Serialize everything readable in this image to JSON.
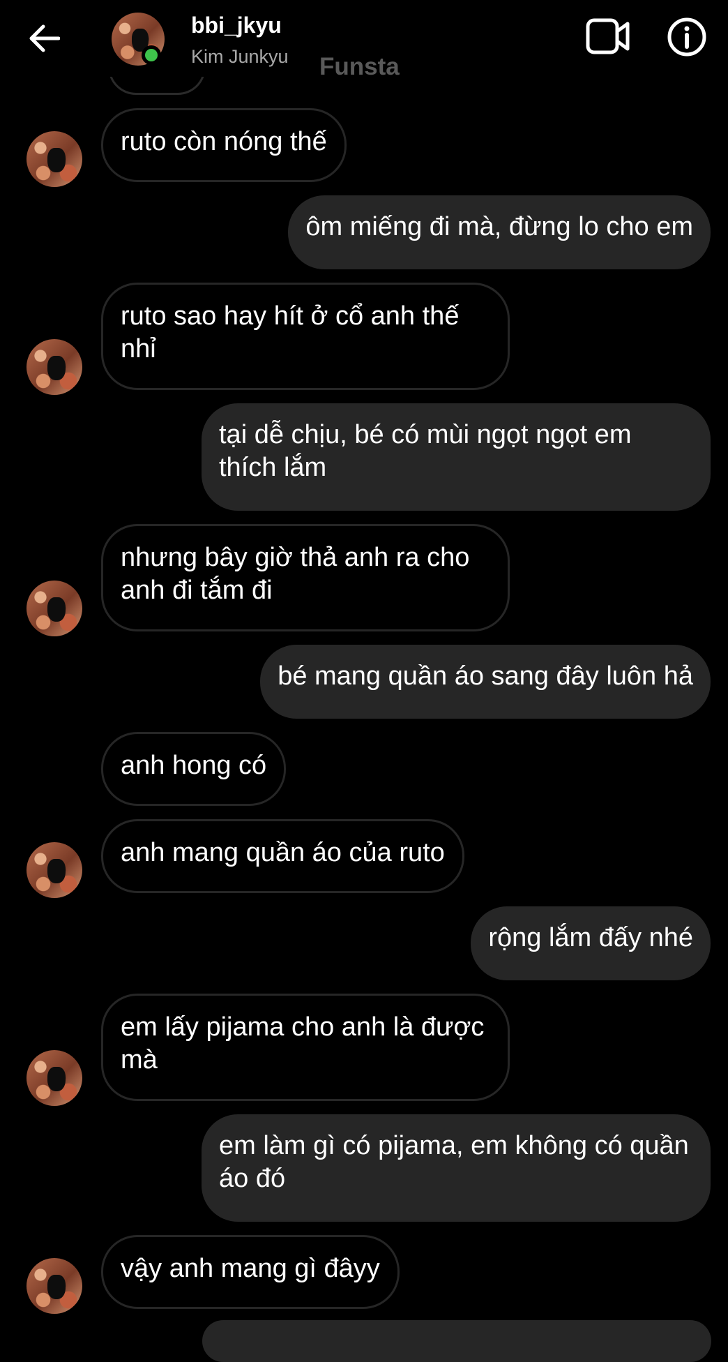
{
  "header": {
    "username": "bbi_jkyu",
    "fullname": "Kim Junkyu",
    "watermark": "Funsta",
    "back_icon": "arrow-left-icon",
    "video_icon": "video-camera-icon",
    "info_icon": "info-circle-icon",
    "online_color": "#3ec34b"
  },
  "messages": [
    {
      "from": "them",
      "text": "ruto còn nóng thế"
    },
    {
      "from": "me",
      "text": "ôm miếng đi mà, đừng lo cho em"
    },
    {
      "from": "them",
      "text": "ruto sao hay hít ở cổ anh thế nhỉ"
    },
    {
      "from": "me",
      "text": "tại dễ chịu, bé có mùi ngọt ngọt em thích lắm"
    },
    {
      "from": "them",
      "text": "nhưng bây giờ thả anh ra cho anh đi tắm đi"
    },
    {
      "from": "me",
      "text": "bé mang quần áo sang đây luôn hả"
    },
    {
      "from": "them",
      "text": "anh hong có"
    },
    {
      "from": "them",
      "text": "anh mang quần áo của ruto"
    },
    {
      "from": "me",
      "text": "rộng lắm đấy nhé"
    },
    {
      "from": "them",
      "text": "em lấy pijama cho anh là được mà"
    },
    {
      "from": "me",
      "text": "em làm gì có pijama, em không có quần áo đó"
    },
    {
      "from": "them",
      "text": "vậy anh mang gì đâyy"
    }
  ],
  "colors": {
    "background": "#000000",
    "outgoing_bubble": "#262626",
    "incoming_border": "#262626",
    "secondary_text": "#a8a8a8"
  }
}
